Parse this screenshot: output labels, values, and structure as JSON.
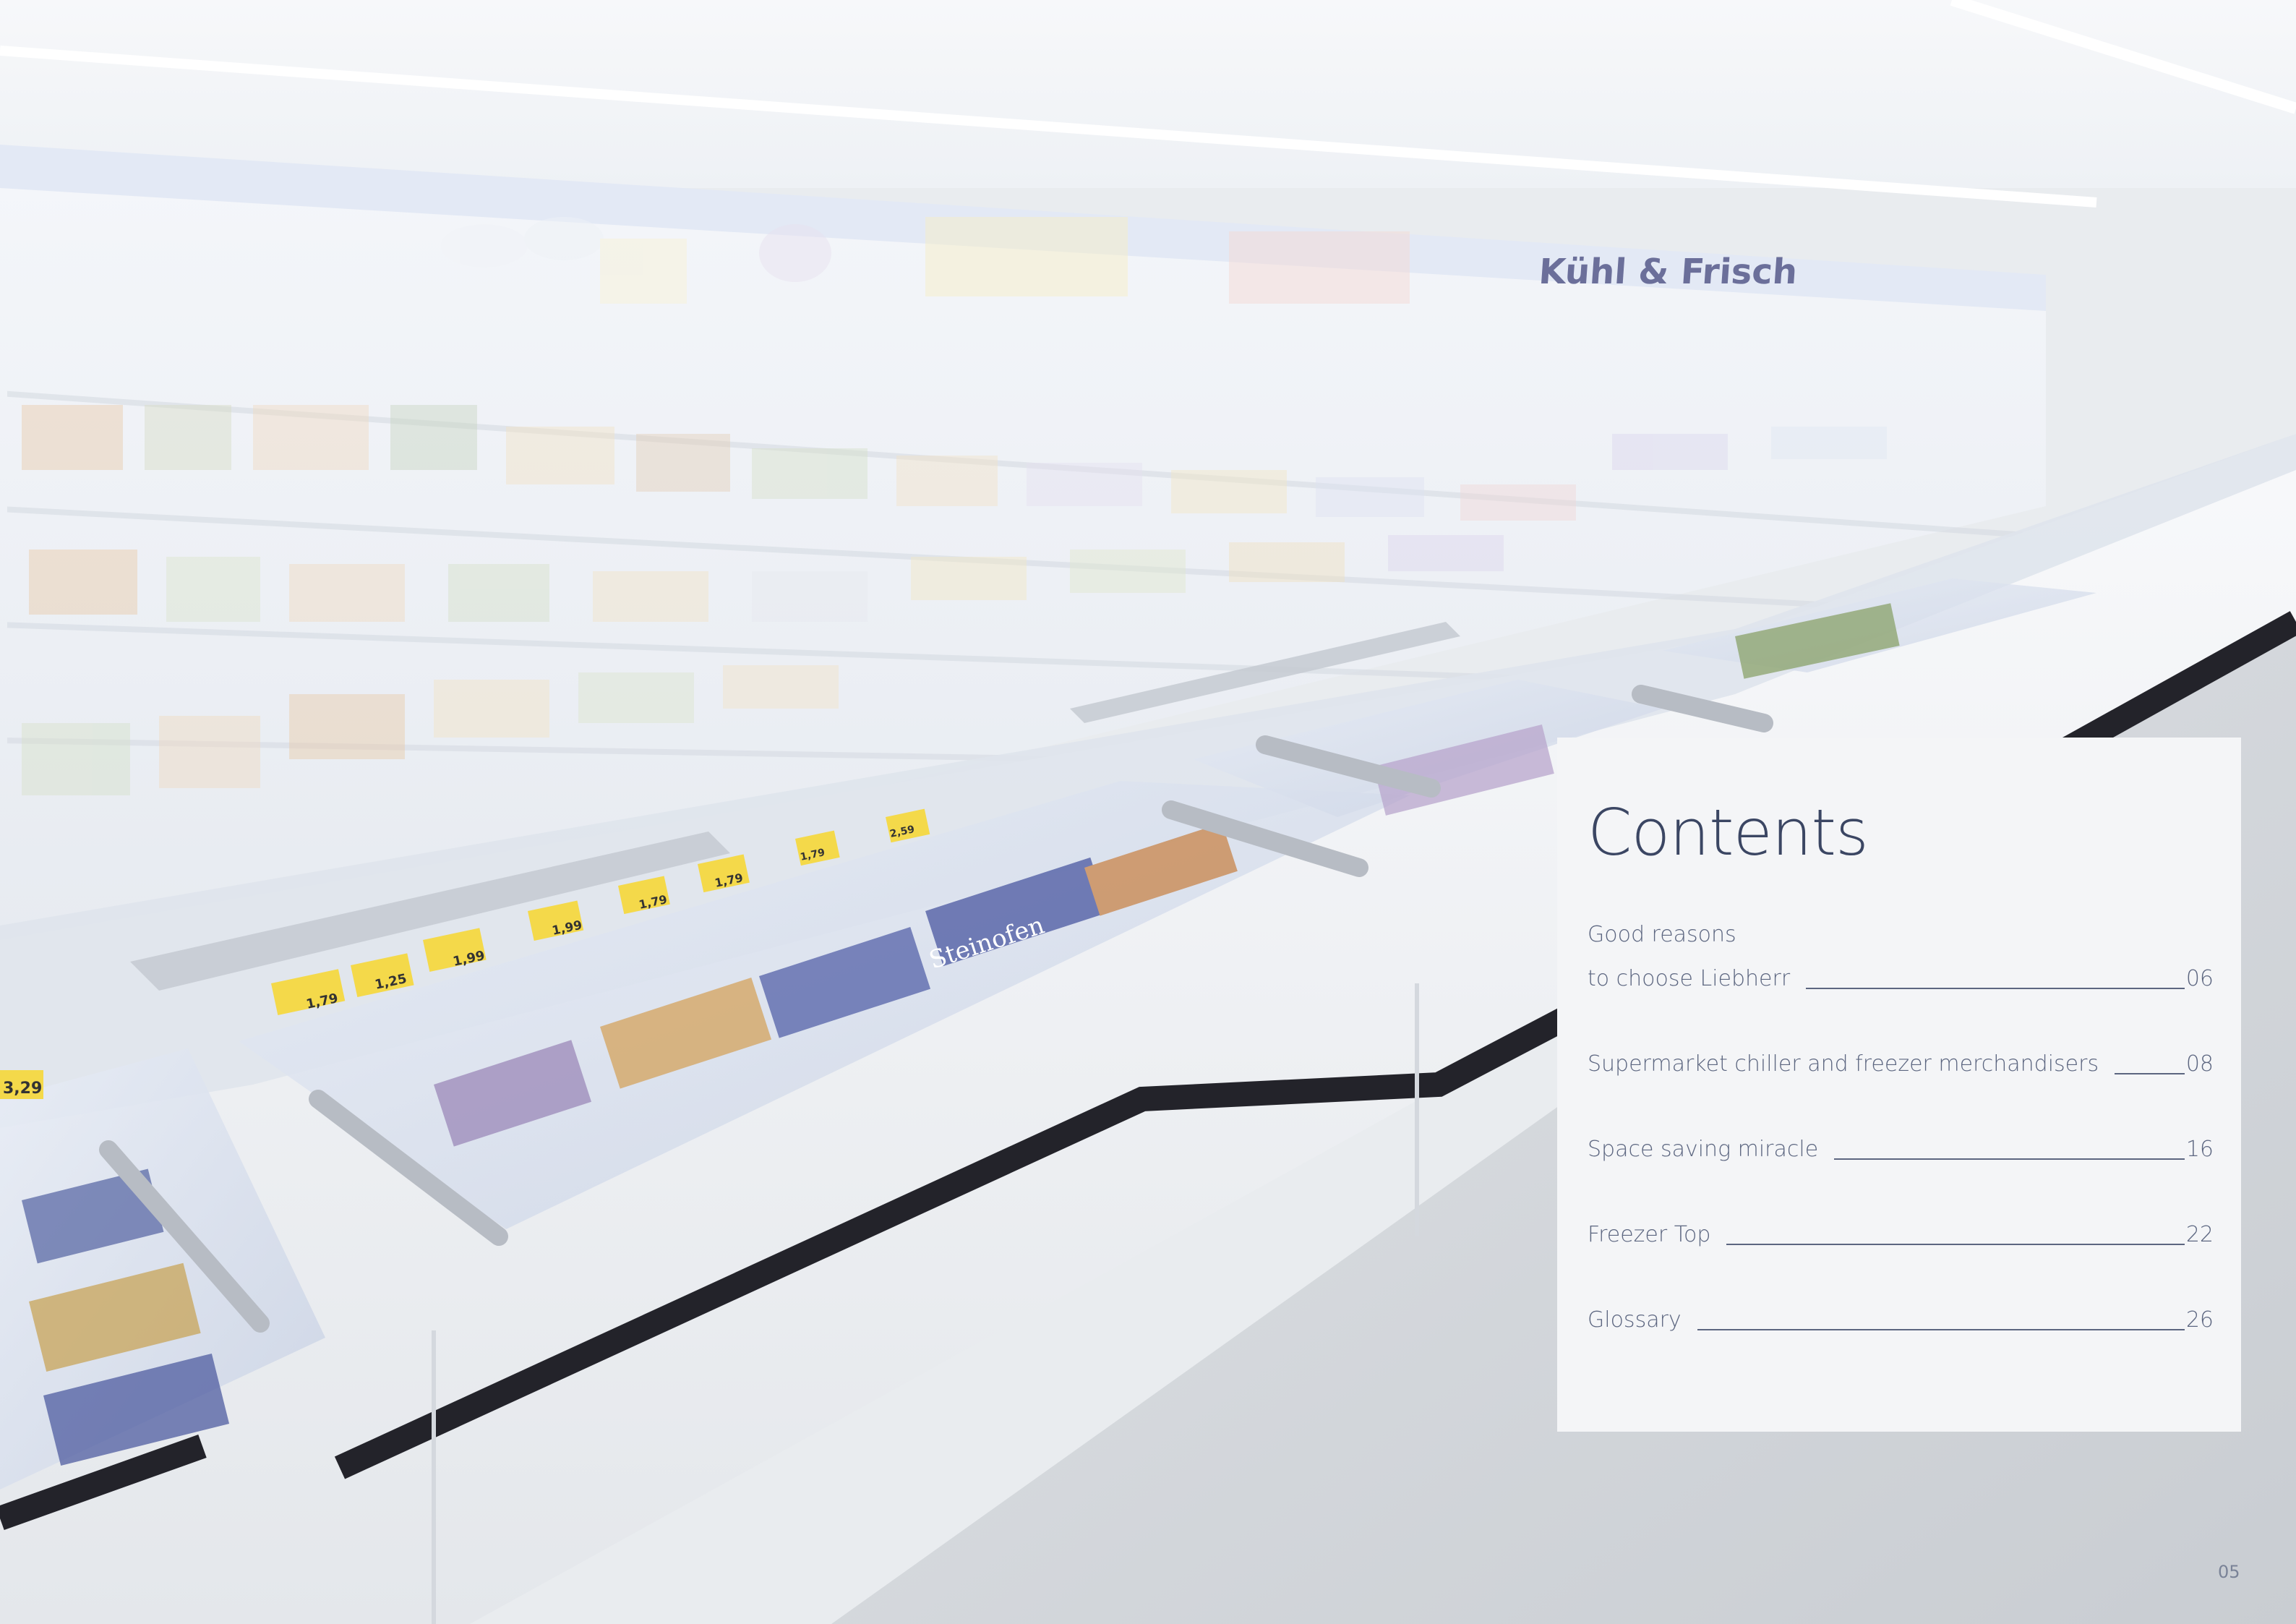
{
  "photo": {
    "signage_text": "Kühl & Frisch",
    "price_tags": [
      "3,29",
      "1,79",
      "1,25",
      "1,99",
      "1,99",
      "1,79",
      "1,79",
      "1,79",
      "2,59"
    ],
    "brand_on_packs": "Steinofen"
  },
  "contents": {
    "title": "Contents",
    "entries": [
      {
        "label_line1": "Good reasons",
        "label": "to choose Liebherr",
        "page": "06"
      },
      {
        "label": "Supermarket chiller and freezer merchandisers",
        "page": "08"
      },
      {
        "label": "Space saving miracle",
        "page": "16"
      },
      {
        "label": "Freezer Top",
        "page": "22"
      },
      {
        "label": "Glossary",
        "page": "26"
      }
    ]
  },
  "page_number": "05"
}
